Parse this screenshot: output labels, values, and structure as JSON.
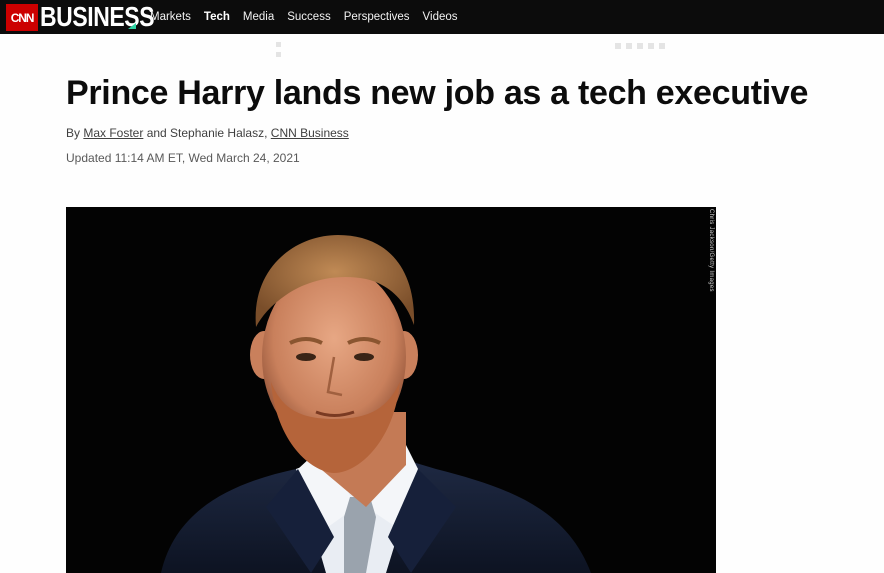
{
  "header": {
    "cnn_logo": "CNN",
    "section_logo": "BUSINESS",
    "nav": [
      {
        "label": "Markets",
        "active": false
      },
      {
        "label": "Tech",
        "active": true
      },
      {
        "label": "Media",
        "active": false
      },
      {
        "label": "Success",
        "active": false
      },
      {
        "label": "Perspectives",
        "active": false
      },
      {
        "label": "Videos",
        "active": false
      }
    ]
  },
  "article": {
    "headline": "Prince Harry lands new job as a tech executive",
    "byline": {
      "prefix": "By ",
      "author1": "Max Foster",
      "middle": " and Stephanie Halasz, ",
      "outlet": "CNN Business"
    },
    "timestamp": "Updated 11:14 AM ET, Wed March 24, 2021",
    "image_credit": "Chris Jackson/Getty Images"
  },
  "colors": {
    "brand_red": "#cc0000",
    "topbar": "#0c0c0c",
    "accent_green": "#2ed3a3"
  }
}
